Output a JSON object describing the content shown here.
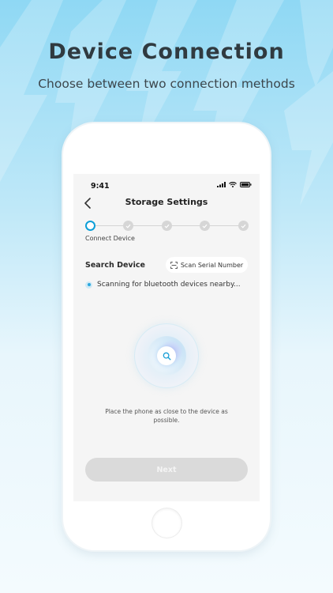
{
  "promo": {
    "headline": "Device Connection",
    "subline": "Choose between two connection methods"
  },
  "status_bar": {
    "time": "9:41",
    "icons": [
      "signal-icon",
      "wifi-icon",
      "battery-icon"
    ]
  },
  "nav": {
    "back_icon": "chevron-left-icon",
    "title": "Storage Settings"
  },
  "stepper": {
    "total_steps": 5,
    "current_step": 1,
    "current_label": "Connect Device"
  },
  "search": {
    "label": "Search Device",
    "scan_button_label": "Scan Serial Number",
    "scan_button_icon": "scan-icon"
  },
  "scanning": {
    "text": "Scanning for bluetooth devices nearby..."
  },
  "radar": {
    "center_icon": "search-icon"
  },
  "hint": {
    "text": "Place the phone as close to the device as possible."
  },
  "next_button": {
    "label": "Next",
    "enabled": false
  },
  "colors": {
    "accent": "#0d9fd8",
    "button_disabled": "#dadada",
    "background_top": "#8fd8f4",
    "background_bottom": "#f4fbfe"
  }
}
